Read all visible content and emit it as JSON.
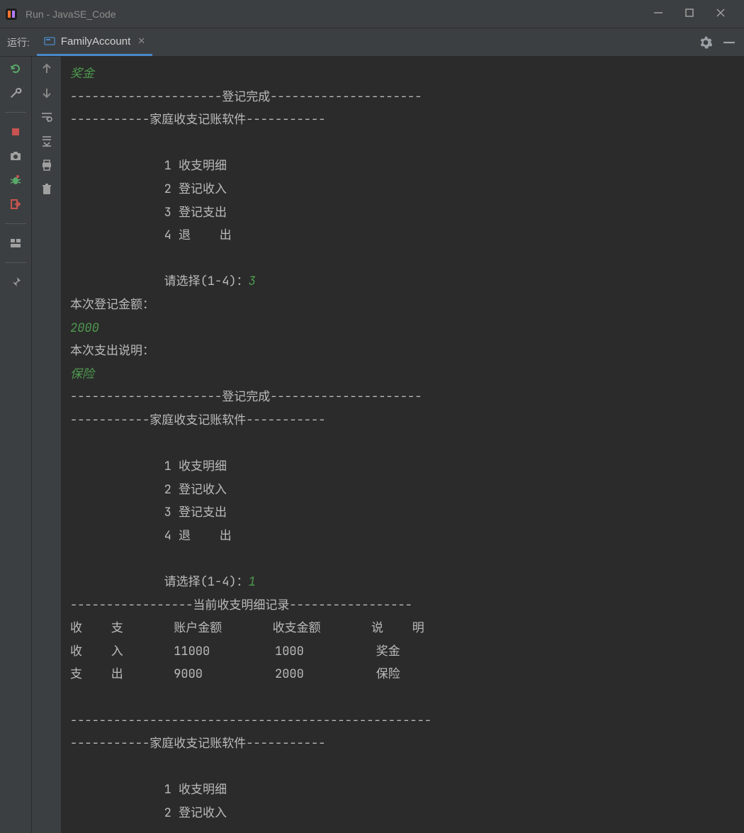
{
  "window": {
    "title": "Run - JavaSE_Code"
  },
  "toolbar": {
    "run_label": "运行:",
    "tab_label": "FamilyAccount"
  },
  "console": {
    "bonus_input": "奖金",
    "divider_done": "---------------------登记完成---------------------",
    "divider_app": "-----------家庭收支记账软件-----------",
    "menu1": "             1 收支明细",
    "menu2": "             2 登记收入",
    "menu3": "             3 登记支出",
    "menu4": "             4 退    出",
    "prompt_select": "             请选择(1-4)：",
    "input_3": "3",
    "amount_label": "本次登记金额：",
    "amount_input": "2000",
    "expense_desc_label": "本次支出说明：",
    "expense_desc_input": "保险",
    "input_1": "1",
    "divider_record": "-----------------当前收支明细记录-----------------",
    "table_header": "收    支       账户金额       收支金额       说    明",
    "table_row1": "收    入       11000         1000          奖金",
    "table_row2": "支    出       9000          2000          保险",
    "divider_long": "--------------------------------------------------"
  }
}
